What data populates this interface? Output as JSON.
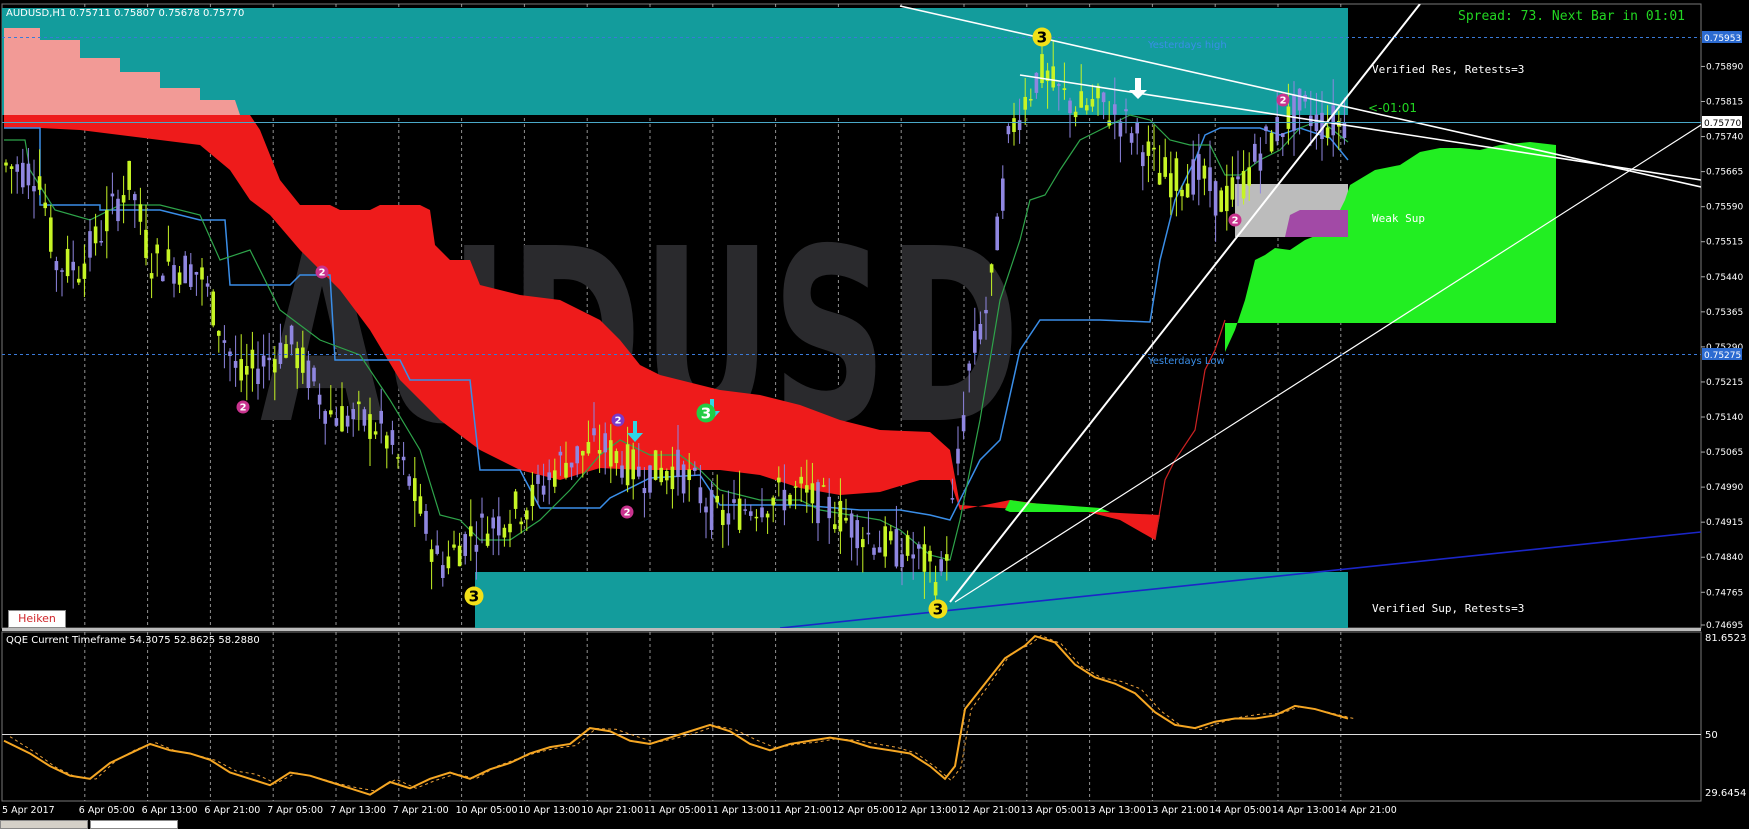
{
  "chart_data": {
    "type": "candlestick",
    "header": "AUDUSD,H1  0.75711 0.75807 0.75678 0.75770",
    "watermark": "AUDUSD",
    "info": "Spread: 73. Next Bar in 01:01",
    "bar_timer": "<-01:01",
    "price_ticks": [
      "0.75953",
      "0.75890",
      "0.75815",
      "0.75770",
      "0.75740",
      "0.75665",
      "0.75590",
      "0.75515",
      "0.75440",
      "0.75365",
      "0.75290",
      "0.75275",
      "0.75215",
      "0.75140",
      "0.75065",
      "0.74990",
      "0.74915",
      "0.74840",
      "0.74765",
      "0.74695"
    ],
    "time_ticks": [
      "5 Apr 2017",
      "6 Apr 05:00",
      "6 Apr 13:00",
      "6 Apr 21:00",
      "7 Apr 05:00",
      "7 Apr 13:00",
      "7 Apr 21:00",
      "10 Apr 05:00",
      "10 Apr 13:00",
      "10 Apr 21:00",
      "11 Apr 05:00",
      "11 Apr 13:00",
      "11 Apr 21:00",
      "12 Apr 05:00",
      "12 Apr 13:00",
      "12 Apr 21:00",
      "13 Apr 05:00",
      "13 Apr 13:00",
      "13 Apr 21:00",
      "14 Apr 05:00",
      "14 Apr 13:00",
      "14 Apr 21:00"
    ],
    "current_price": "0.75770",
    "yesterday_high": {
      "label": "Yesterdays high",
      "price": "0.75953"
    },
    "yesterday_low": {
      "label": "Yesterdays Low",
      "price": "0.75275"
    },
    "zones": [
      {
        "label": "Verified Res, Retests=3"
      },
      {
        "label": "Weak Sup"
      },
      {
        "label": "Verified Sup, Retests=3"
      }
    ],
    "markers": [
      "3",
      "3",
      "3",
      "3",
      "2",
      "2",
      "2",
      "2",
      "2",
      "2"
    ],
    "subwindow": {
      "title": "QQE Current Timeframe 54.3075 52.8625 58.2880",
      "ticks": [
        "81.6523",
        "50",
        "29.6454"
      ]
    },
    "heiken_button": "Heiken"
  }
}
